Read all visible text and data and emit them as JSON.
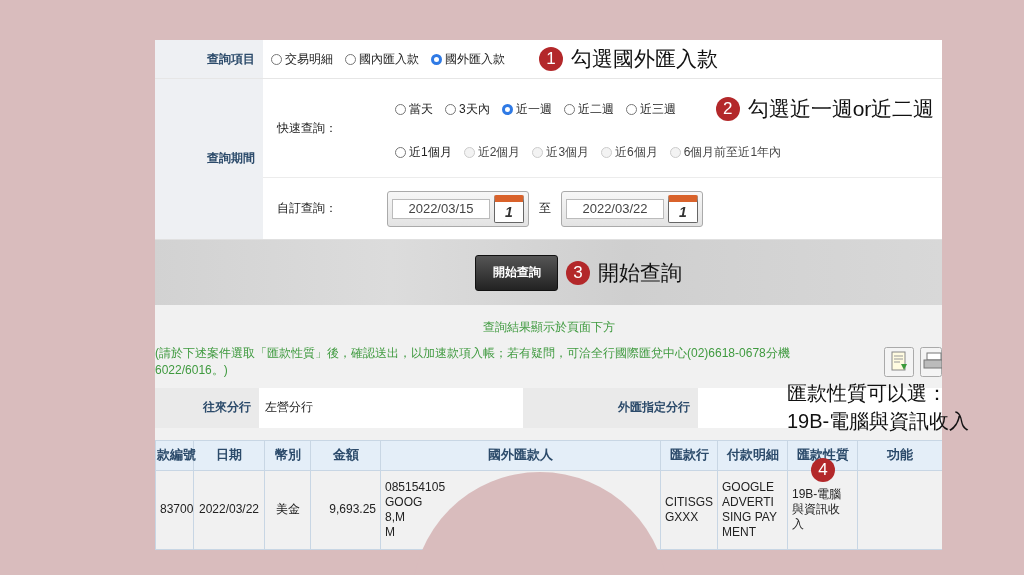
{
  "query_item": {
    "label": "查詢項目",
    "options": [
      {
        "label": "交易明細",
        "selected": false
      },
      {
        "label": "國內匯入款",
        "selected": false
      },
      {
        "label": "國外匯入款",
        "selected": true
      }
    ],
    "note": {
      "number": "1",
      "text": "勾選國外匯入款"
    }
  },
  "query_period": {
    "label": "查詢期間",
    "quick": {
      "label": "快速查詢：",
      "rows": [
        [
          {
            "label": "當天",
            "selected": false,
            "disabled": false
          },
          {
            "label": "3天內",
            "selected": false,
            "disabled": false
          },
          {
            "label": "近一週",
            "selected": true,
            "disabled": false
          },
          {
            "label": "近二週",
            "selected": false,
            "disabled": false
          },
          {
            "label": "近三週",
            "selected": false,
            "disabled": false
          }
        ],
        [
          {
            "label": "近1個月",
            "selected": false,
            "disabled": false
          },
          {
            "label": "近2個月",
            "selected": false,
            "disabled": true
          },
          {
            "label": "近3個月",
            "selected": false,
            "disabled": true
          },
          {
            "label": "近6個月",
            "selected": false,
            "disabled": true
          },
          {
            "label": "6個月前至近1年內",
            "selected": false,
            "disabled": true
          }
        ]
      ],
      "note": {
        "number": "2",
        "text": "勾選近一週or近二週"
      }
    },
    "custom": {
      "label": "自訂查詢：",
      "from": "2022/03/15",
      "from_calendar_day": "1",
      "separator": "至",
      "to": "2022/03/22",
      "to_calendar_day": "1"
    }
  },
  "search": {
    "button": "開始查詢",
    "note": {
      "number": "3",
      "text": "開始查詢"
    }
  },
  "result_notice": "查詢結果顯示於頁面下方",
  "instructions": "(請於下述案件選取「匯款性質」後，確認送出，以加速款項入帳；若有疑問，可洽全行國際匯兌中心(02)6618-0678分機6022/6016。)",
  "branch_row": [
    {
      "label": "往來分行",
      "value": "左營分行"
    },
    {
      "label": "外匯指定分行"
    }
  ],
  "table": {
    "columns": [
      "款編號",
      "日期",
      "幣別",
      "金額",
      "國外匯款人",
      "匯款行",
      "付款明細",
      "匯款性質",
      "功能"
    ],
    "rows": [
      {
        "cells": [
          "83700",
          "2022/03/22",
          "美金",
          "9,693.25",
          "085154105\nGOOG\n8,M\nM",
          "CITISGS\nGXXX",
          "GOOGLE\nADVERTI\nSING PAY\nMENT",
          "19B-電腦與資訊收入"
        ]
      }
    ],
    "note": {
      "number": "4"
    },
    "callout": [
      "匯款性質可以選：",
      "19B-電腦與資訊收入"
    ]
  }
}
